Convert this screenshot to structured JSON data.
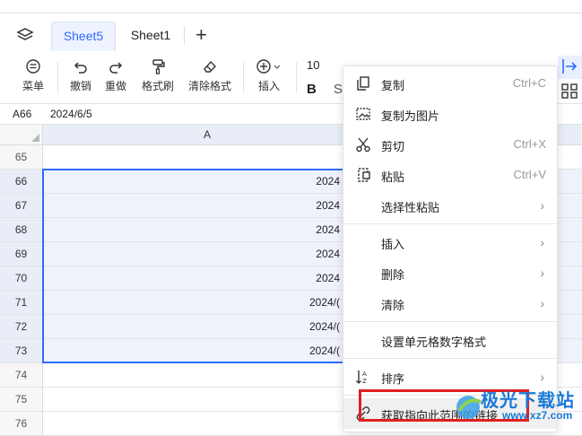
{
  "tabs": {
    "active": "Sheet5",
    "other": "Sheet1",
    "add": "+"
  },
  "toolbar": {
    "menu": "菜单",
    "undo": "撤销",
    "redo": "重做",
    "format_painter": "格式刷",
    "clear_format": "清除格式",
    "insert": "插入",
    "font_size": "10",
    "bold": "B",
    "italic": "S"
  },
  "formula": {
    "cell_ref": "A66",
    "value": "2024/6/5"
  },
  "columns": {
    "a": "A"
  },
  "rows": [
    {
      "n": "65",
      "v": ""
    },
    {
      "n": "66",
      "v": "2024"
    },
    {
      "n": "67",
      "v": "2024"
    },
    {
      "n": "68",
      "v": "2024"
    },
    {
      "n": "69",
      "v": "2024"
    },
    {
      "n": "70",
      "v": "2024"
    },
    {
      "n": "71",
      "v": "2024/("
    },
    {
      "n": "72",
      "v": "2024/("
    },
    {
      "n": "73",
      "v": "2024/("
    },
    {
      "n": "74",
      "v": ""
    },
    {
      "n": "75",
      "v": ""
    },
    {
      "n": "76",
      "v": ""
    }
  ],
  "context_menu": {
    "copy": "复制",
    "copy_sc": "Ctrl+C",
    "copy_as_image": "复制为图片",
    "cut": "剪切",
    "cut_sc": "Ctrl+X",
    "paste": "粘贴",
    "paste_sc": "Ctrl+V",
    "paste_special": "选择性粘贴",
    "insert": "插入",
    "delete": "删除",
    "clear": "清除",
    "number_format": "设置单元格数字格式",
    "sort": "排序",
    "get_link": "获取指向此范围的链接",
    "chevron": "›"
  },
  "watermark": {
    "text": "极光下载站",
    "url": "www.xz7.com"
  },
  "colors": {
    "accent": "#2f6bff",
    "highlight_red": "#e02020"
  }
}
